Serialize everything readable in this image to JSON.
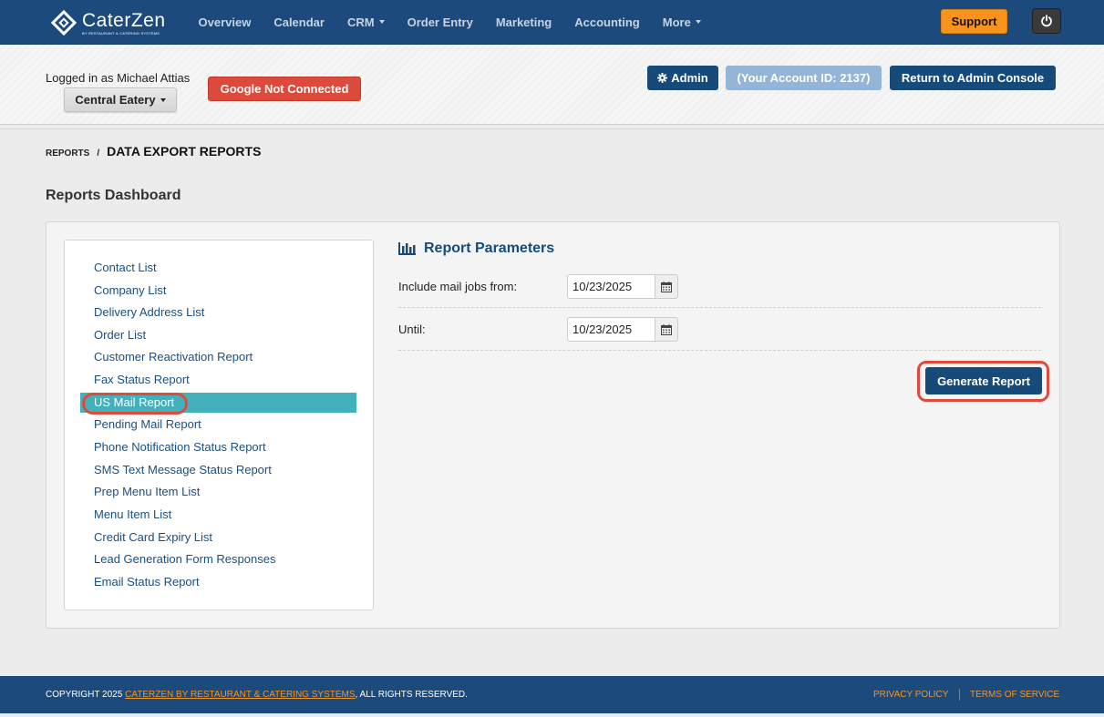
{
  "app": {
    "brand": "CaterZen",
    "brand_sub": "BY RESTAURANT & CATERING SYSTEMS"
  },
  "nav": {
    "items": [
      {
        "label": "Overview",
        "dropdown": false
      },
      {
        "label": "Calendar",
        "dropdown": false
      },
      {
        "label": "CRM",
        "dropdown": true
      },
      {
        "label": "Order Entry",
        "dropdown": false
      },
      {
        "label": "Marketing",
        "dropdown": false
      },
      {
        "label": "Accounting",
        "dropdown": false
      },
      {
        "label": "More",
        "dropdown": true
      }
    ],
    "support_label": "Support",
    "power_icon": "power-icon"
  },
  "header": {
    "logged_in": "Logged in as Michael Attias",
    "location": "Central Eatery",
    "google_status": "Google Not Connected",
    "admin_label": "Admin",
    "account_id": "(Your Account ID: 2137)",
    "return_label": "Return to Admin Console"
  },
  "breadcrumb": {
    "parent": "REPORTS",
    "separator": "/",
    "current": "DATA EXPORT REPORTS"
  },
  "dashboard_title": "Reports Dashboard",
  "reports": {
    "active_index": 6,
    "items": [
      "Contact List",
      "Company List",
      "Delivery Address List",
      "Order List",
      "Customer Reactivation Report",
      "Fax Status Report",
      "US Mail Report",
      "Pending Mail Report",
      "Phone Notification Status Report",
      "SMS Text Message Status Report",
      "Prep Menu Item List",
      "Menu Item List",
      "Credit Card Expiry List",
      "Lead Generation Form Responses",
      "Email Status Report"
    ]
  },
  "params": {
    "title": "Report Parameters",
    "from_label": "Include mail jobs from:",
    "from_value": "10/23/2025",
    "until_label": "Until:",
    "until_value": "10/23/2025",
    "generate_label": "Generate Report"
  },
  "footer": {
    "copyright_prefix": "COPYRIGHT 2025",
    "copyright_link": "CATERZEN BY RESTAURANT & CATERING SYSTEMS",
    "copyright_suffix": ", ALL RIGHTS RESERVED.",
    "privacy": "PRIVACY POLICY",
    "terms": "TERMS OF SERVICE"
  },
  "colors": {
    "nav_bg": "#1c4a7c",
    "primary": "#164a79",
    "support": "#f7941d",
    "danger": "#dc4a3c",
    "active_row": "#43b1bb",
    "highlight": "#e04a3a"
  }
}
